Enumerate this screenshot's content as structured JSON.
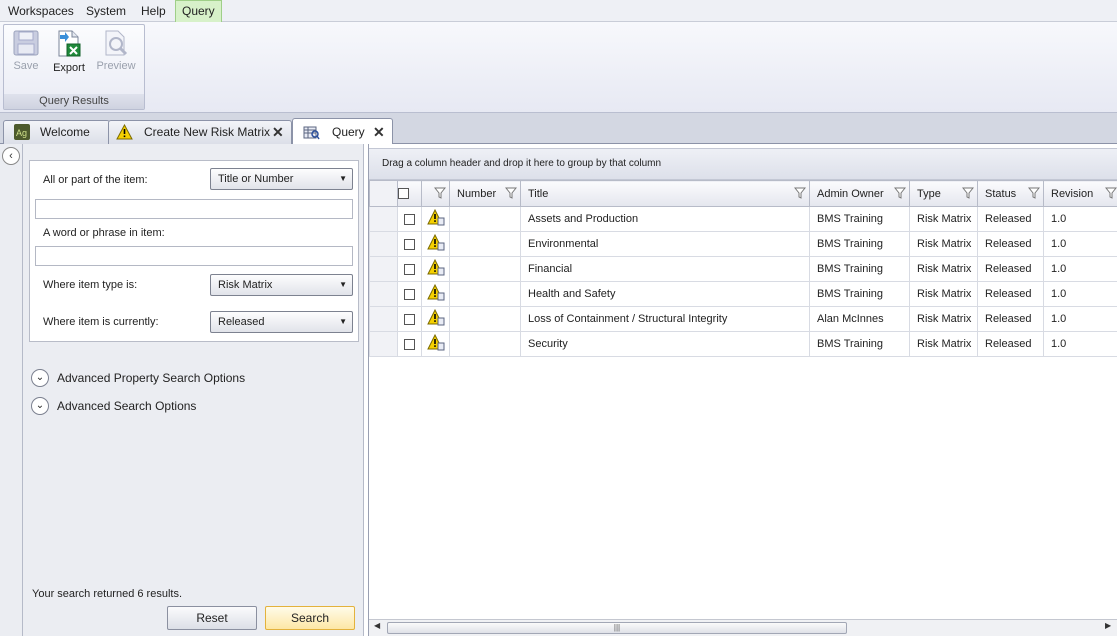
{
  "menubar": {
    "items": [
      "Workspaces",
      "System",
      "Help",
      "Query"
    ]
  },
  "ribbon": {
    "buttons": [
      {
        "label": "Save",
        "icon": "floppy-disk-icon",
        "enabled": false
      },
      {
        "label": "Export",
        "icon": "excel-export-icon",
        "enabled": true
      },
      {
        "label": "Preview",
        "icon": "print-preview-icon",
        "enabled": false
      }
    ],
    "group_label": "Query Results"
  },
  "tabs": [
    {
      "label": "Welcome",
      "icon": "ag-logo-icon",
      "closable": false
    },
    {
      "label": "Create New Risk Matrix",
      "icon": "warning-icon",
      "closable": true
    },
    {
      "label": "Query",
      "icon": "query-icon",
      "closable": true,
      "active": true
    }
  ],
  "search": {
    "item_label": "All or part of the item:",
    "item_scope": "Title or Number",
    "item_value": "",
    "phrase_label": "A word or phrase in item:",
    "phrase_value": "",
    "type_label": "Where item type is:",
    "type_value": "Risk Matrix",
    "status_label": "Where item is currently:",
    "status_value": "Released",
    "advanced_property": "Advanced Property Search Options",
    "advanced_search": "Advanced Search Options",
    "result_text": "Your search returned 6 results.",
    "reset_label": "Reset",
    "search_label": "Search"
  },
  "grid": {
    "group_hint": "Drag a column header and drop it here to group by that column",
    "columns": [
      "Number",
      "Title",
      "Admin Owner",
      "Type",
      "Status",
      "Revision"
    ],
    "rows": [
      {
        "number": "",
        "title": "Assets and Production",
        "owner": "BMS Training",
        "type": "Risk Matrix",
        "status": "Released",
        "revision": "1.0"
      },
      {
        "number": "",
        "title": "Environmental",
        "owner": "BMS Training",
        "type": "Risk Matrix",
        "status": "Released",
        "revision": "1.0"
      },
      {
        "number": "",
        "title": "Financial",
        "owner": "BMS Training",
        "type": "Risk Matrix",
        "status": "Released",
        "revision": "1.0"
      },
      {
        "number": "",
        "title": "Health and Safety",
        "owner": "BMS Training",
        "type": "Risk Matrix",
        "status": "Released",
        "revision": "1.0"
      },
      {
        "number": "",
        "title": "Loss of Containment / Structural Integrity",
        "owner": "Alan McInnes",
        "type": "Risk Matrix",
        "status": "Released",
        "revision": "1.0"
      },
      {
        "number": "",
        "title": "Security",
        "owner": "BMS Training",
        "type": "Risk Matrix",
        "status": "Released",
        "revision": "1.0"
      }
    ]
  },
  "colors": {
    "active_menu_bg": "#d7f1c9",
    "search_button_border": "#e3b23c",
    "warning_yellow": "#f5d000"
  }
}
